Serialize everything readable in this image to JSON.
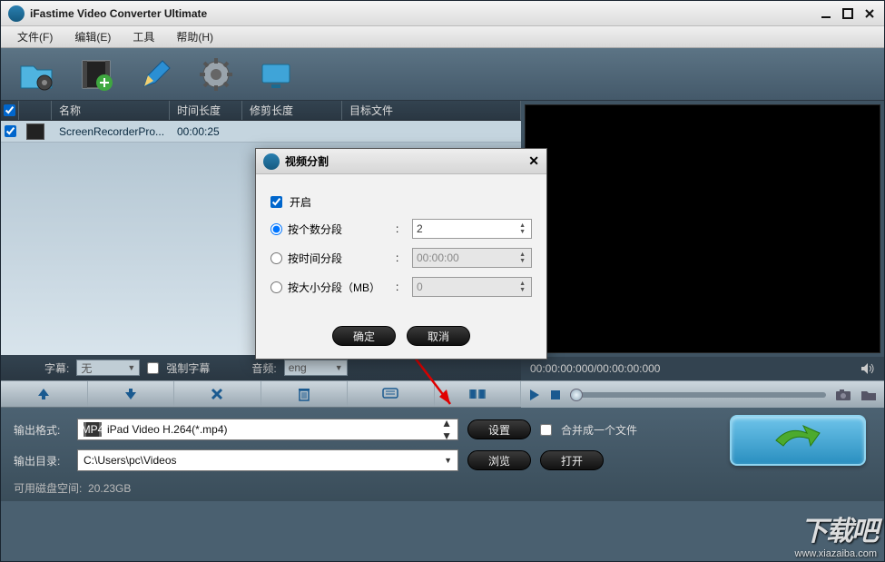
{
  "title": "iFastime Video Converter Ultimate",
  "menu": {
    "file": "文件(F)",
    "edit": "编辑(E)",
    "tools": "工具",
    "help": "帮助(H)"
  },
  "list_header": {
    "name": "名称",
    "duration": "时间长度",
    "trim": "修剪长度",
    "target": "目标文件"
  },
  "rows": [
    {
      "name": "ScreenRecorderPro...",
      "duration": "00:00:25"
    }
  ],
  "sub_audio": {
    "subtitle_label": "字幕:",
    "subtitle_value": "无",
    "force_sub": "强制字幕",
    "audio_label": "音频:",
    "audio_value": "eng"
  },
  "preview": {
    "time": "00:00:00:000/00:00:00:000"
  },
  "output": {
    "format_label": "输出格式:",
    "format_value": "iPad Video H.264(*.mp4)",
    "settings_btn": "设置",
    "merge_label": "合并成一个文件",
    "dir_label": "输出目录:",
    "dir_value": "C:\\Users\\pc\\Videos",
    "browse_btn": "浏览",
    "open_btn": "打开",
    "disk_label": "可用磁盘空间:",
    "disk_value": "20.23GB"
  },
  "dialog": {
    "title": "视频分割",
    "enable": "开启",
    "by_count": "按个数分段",
    "by_time": "按时间分段",
    "by_size": "按大小分段（MB）",
    "count_value": "2",
    "time_value": "00:00:00",
    "size_value": "0",
    "ok": "确定",
    "cancel": "取消"
  },
  "watermark": {
    "big": "下载吧",
    "small": "www.xiazaiba.com"
  }
}
